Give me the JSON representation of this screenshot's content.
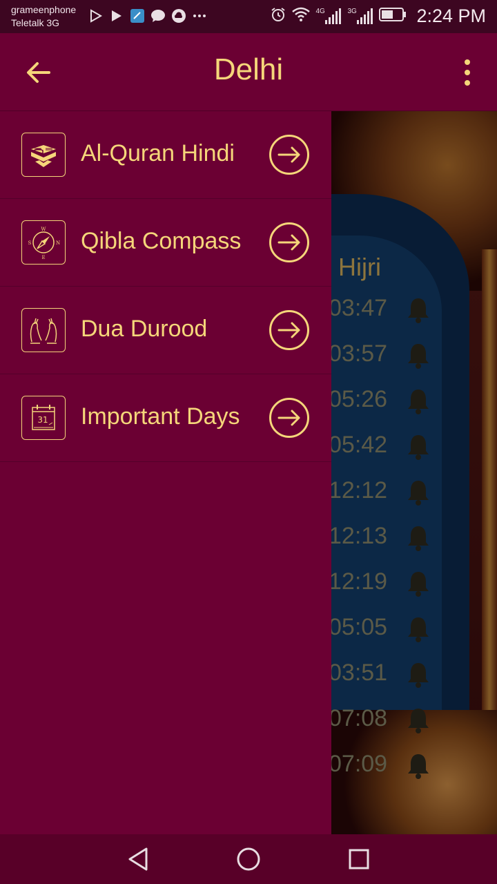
{
  "status_bar": {
    "carrier_1": "grameenphone",
    "carrier_2": "Teletalk 3G",
    "network_1": "4G",
    "network_2": "3G",
    "time": "2:24 PM"
  },
  "app_bar": {
    "title": "Delhi"
  },
  "drawer": {
    "items": [
      {
        "label": "Al-Quran Hindi",
        "icon": "quran-book-icon"
      },
      {
        "label": "Qibla Compass",
        "icon": "compass-icon"
      },
      {
        "label": "Dua Durood",
        "icon": "praying-hands-icon"
      },
      {
        "label": "Important Days",
        "icon": "calendar-icon",
        "calendar_day": "31"
      }
    ]
  },
  "background": {
    "hijri_label": "Hijri",
    "times": [
      "03:47",
      "03:57",
      "05:26",
      "05:42",
      "12:12",
      "12:13",
      "12:19",
      "05:05",
      "03:51",
      "07:08",
      "07:09"
    ]
  },
  "colors": {
    "primary": "#6b0033",
    "accent": "#f5d67a",
    "status_bar": "#3d0621",
    "nav_bar": "#580028"
  }
}
